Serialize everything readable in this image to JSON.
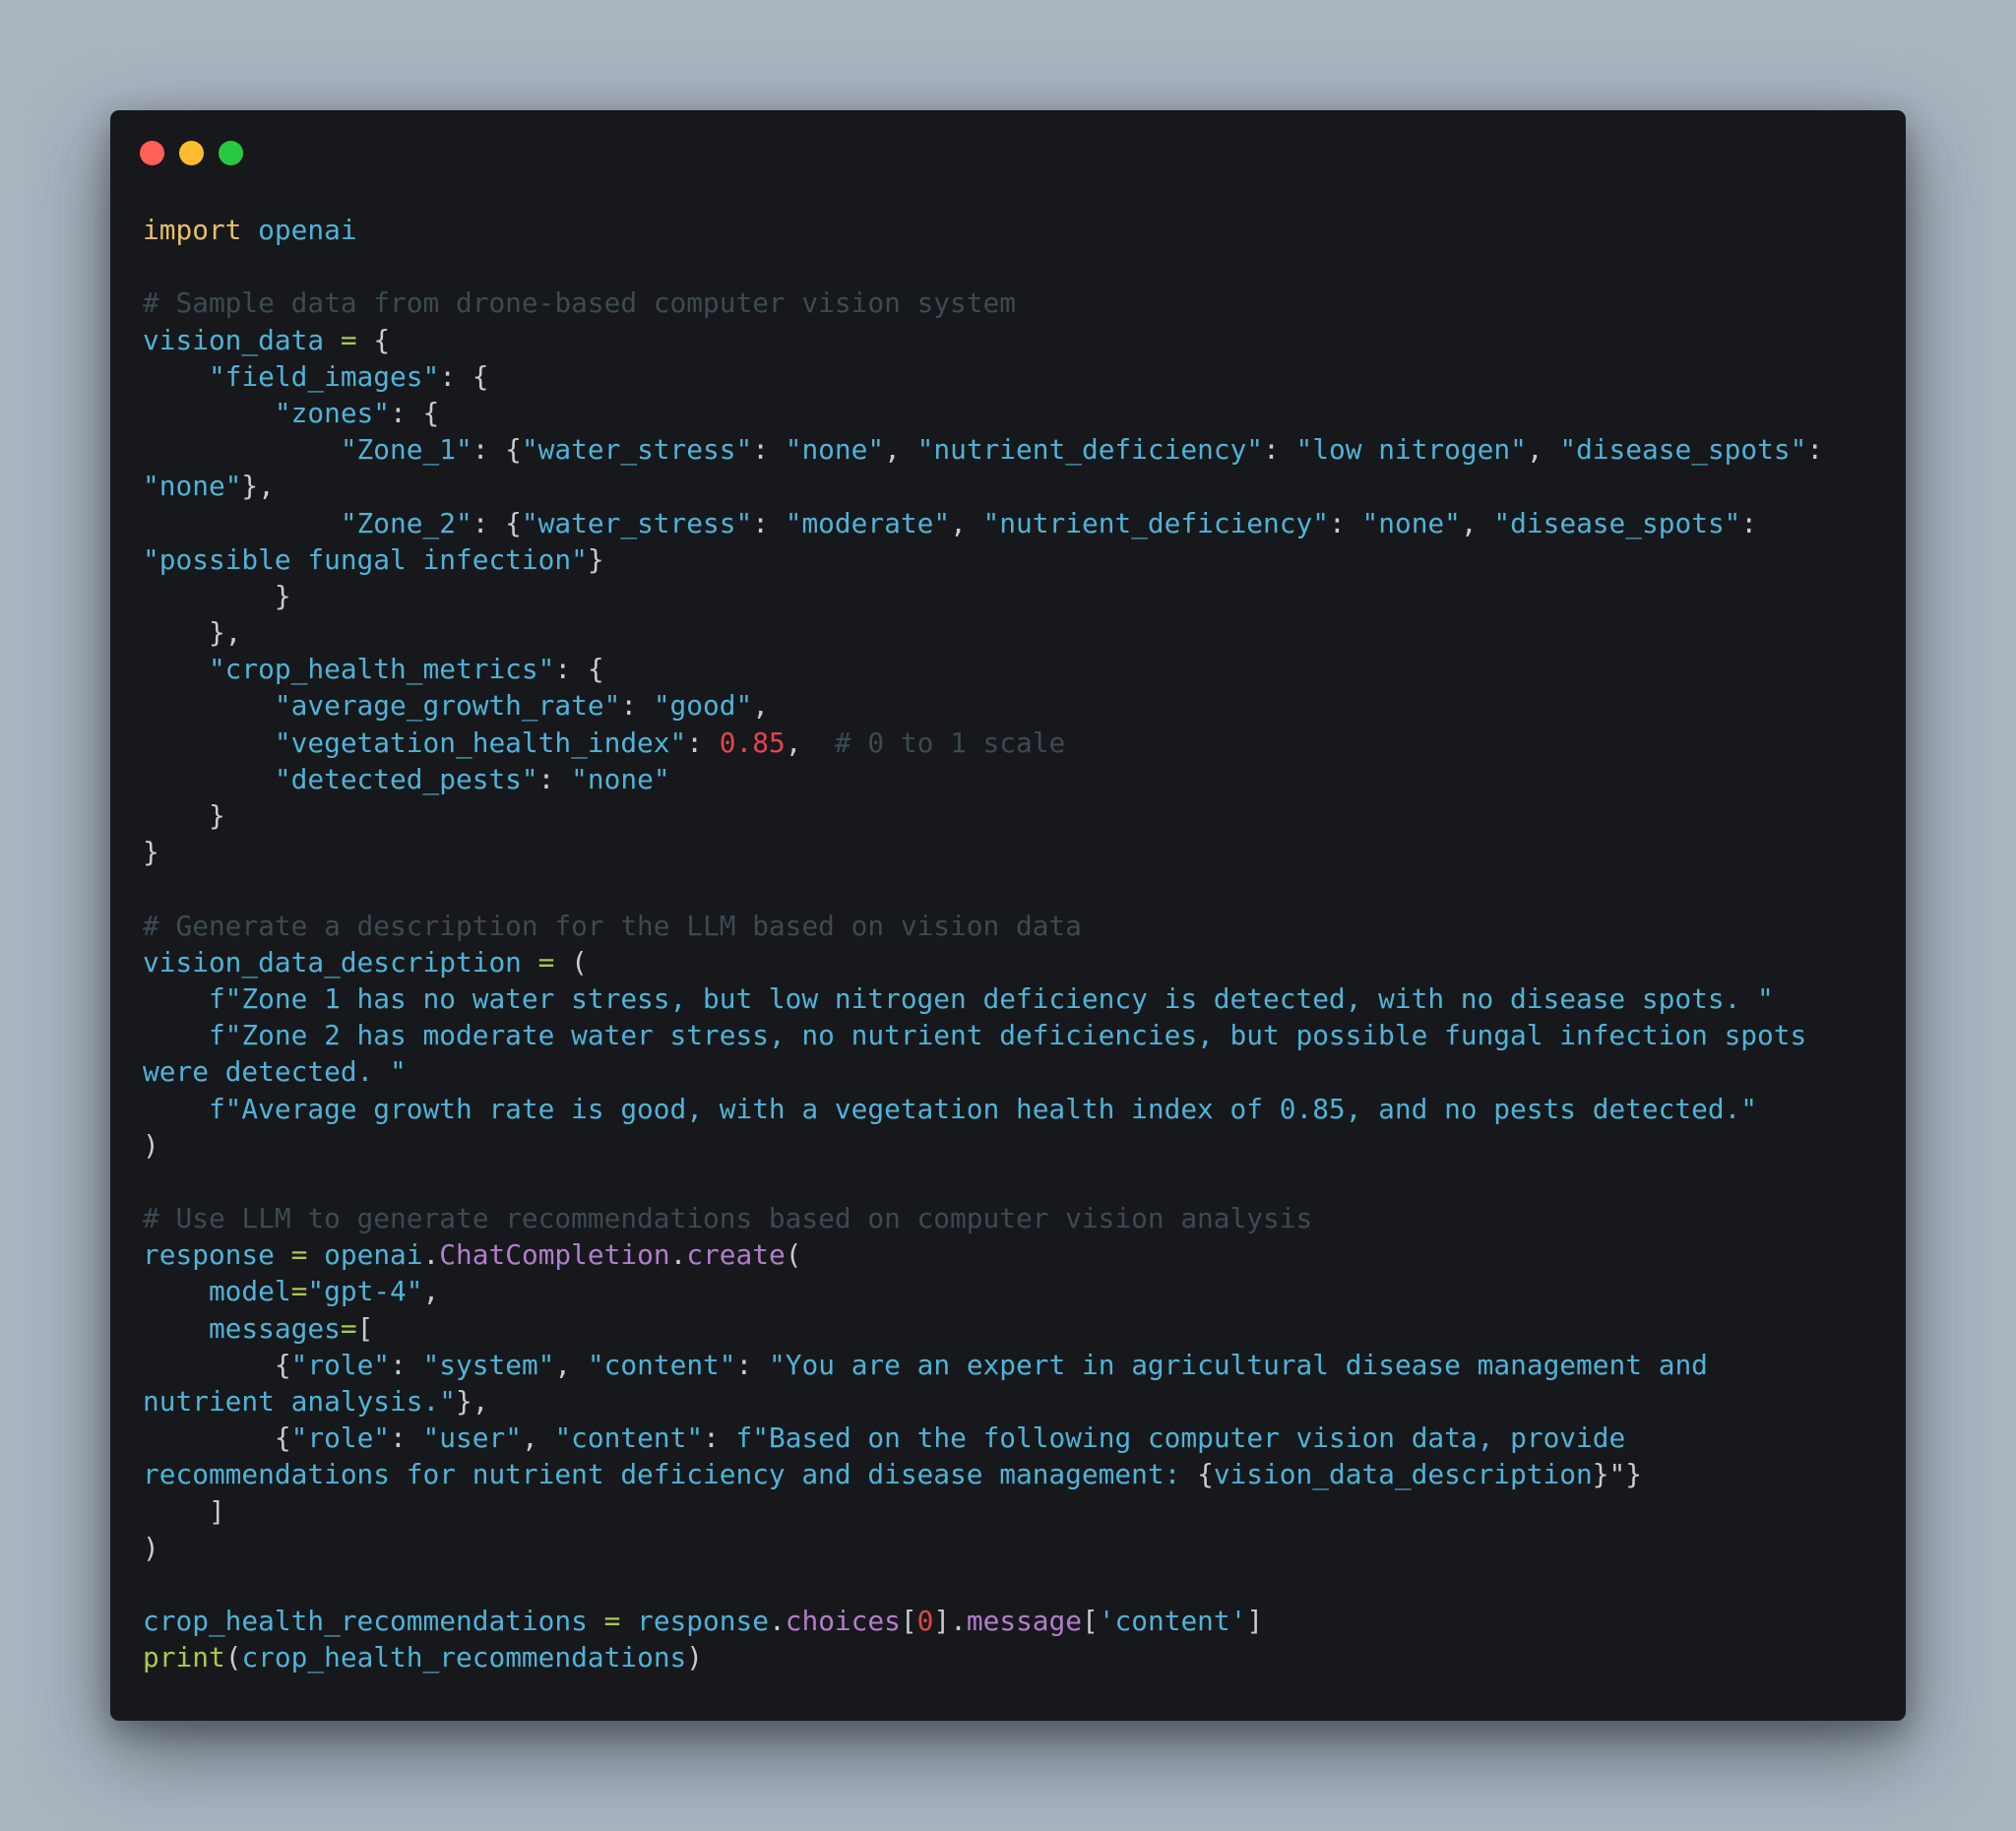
{
  "window": {
    "controls": [
      {
        "name": "close",
        "color": "#ff5f57"
      },
      {
        "name": "minimize",
        "color": "#febc2e"
      },
      {
        "name": "maximize",
        "color": "#28c840"
      }
    ]
  },
  "code": {
    "language": "python",
    "lines": [
      [
        [
          "kw",
          "import"
        ],
        [
          "var",
          " openai"
        ]
      ],
      [],
      [
        [
          "cmt",
          "# Sample data from drone-based computer vision system"
        ]
      ],
      [
        [
          "var",
          "vision_data "
        ],
        [
          "op",
          "="
        ],
        [
          "punc",
          " {"
        ]
      ],
      [
        [
          "str",
          "    \"field_images\""
        ],
        [
          "punc",
          ": {"
        ]
      ],
      [
        [
          "str",
          "        \"zones\""
        ],
        [
          "punc",
          ": {"
        ]
      ],
      [
        [
          "str",
          "            \"Zone_1\""
        ],
        [
          "punc",
          ": {"
        ],
        [
          "str",
          "\"water_stress\""
        ],
        [
          "punc",
          ": "
        ],
        [
          "str",
          "\"none\""
        ],
        [
          "punc",
          ", "
        ],
        [
          "str",
          "\"nutrient_deficiency\""
        ],
        [
          "punc",
          ": "
        ],
        [
          "str",
          "\"low nitrogen\""
        ],
        [
          "punc",
          ", "
        ],
        [
          "str",
          "\"disease_spots\""
        ],
        [
          "punc",
          ":"
        ]
      ],
      [
        [
          "str",
          "\"none\""
        ],
        [
          "punc",
          "},"
        ]
      ],
      [
        [
          "str",
          "            \"Zone_2\""
        ],
        [
          "punc",
          ": {"
        ],
        [
          "str",
          "\"water_stress\""
        ],
        [
          "punc",
          ": "
        ],
        [
          "str",
          "\"moderate\""
        ],
        [
          "punc",
          ", "
        ],
        [
          "str",
          "\"nutrient_deficiency\""
        ],
        [
          "punc",
          ": "
        ],
        [
          "str",
          "\"none\""
        ],
        [
          "punc",
          ", "
        ],
        [
          "str",
          "\"disease_spots\""
        ],
        [
          "punc",
          ":"
        ]
      ],
      [
        [
          "str",
          "\"possible fungal infection\""
        ],
        [
          "punc",
          "}"
        ]
      ],
      [
        [
          "punc",
          "        }"
        ]
      ],
      [
        [
          "punc",
          "    },"
        ]
      ],
      [
        [
          "str",
          "    \"crop_health_metrics\""
        ],
        [
          "punc",
          ": {"
        ]
      ],
      [
        [
          "str",
          "        \"average_growth_rate\""
        ],
        [
          "punc",
          ": "
        ],
        [
          "str",
          "\"good\""
        ],
        [
          "punc",
          ","
        ]
      ],
      [
        [
          "str",
          "        \"vegetation_health_index\""
        ],
        [
          "punc",
          ": "
        ],
        [
          "num",
          "0.85"
        ],
        [
          "punc",
          ",  "
        ],
        [
          "cmt",
          "# 0 to 1 scale"
        ]
      ],
      [
        [
          "str",
          "        \"detected_pests\""
        ],
        [
          "punc",
          ": "
        ],
        [
          "str",
          "\"none\""
        ]
      ],
      [
        [
          "punc",
          "    }"
        ]
      ],
      [
        [
          "punc",
          "}"
        ]
      ],
      [],
      [
        [
          "cmt",
          "# Generate a description for the LLM based on vision data"
        ]
      ],
      [
        [
          "var",
          "vision_data_description "
        ],
        [
          "op",
          "="
        ],
        [
          "punc",
          " ("
        ]
      ],
      [
        [
          "str",
          "    f\"Zone 1 has no water stress, but low nitrogen deficiency is detected, with no disease spots. \""
        ]
      ],
      [
        [
          "str",
          "    f\"Zone 2 has moderate water stress, no nutrient deficiencies, but possible fungal infection spots"
        ]
      ],
      [
        [
          "str",
          "were detected. \""
        ]
      ],
      [
        [
          "str",
          "    f\"Average growth rate is good, with a vegetation health index of 0.85, and no pests detected.\""
        ]
      ],
      [
        [
          "punc",
          ")"
        ]
      ],
      [],
      [
        [
          "cmt",
          "# Use LLM to generate recommendations based on computer vision analysis"
        ]
      ],
      [
        [
          "var",
          "response "
        ],
        [
          "op",
          "="
        ],
        [
          "var",
          " openai"
        ],
        [
          "punc",
          "."
        ],
        [
          "fn",
          "ChatCompletion"
        ],
        [
          "punc",
          "."
        ],
        [
          "fn",
          "create"
        ],
        [
          "punc",
          "("
        ]
      ],
      [
        [
          "var",
          "    model"
        ],
        [
          "op",
          "="
        ],
        [
          "str",
          "\"gpt-4\""
        ],
        [
          "punc",
          ","
        ]
      ],
      [
        [
          "var",
          "    messages"
        ],
        [
          "op",
          "="
        ],
        [
          "punc",
          "["
        ]
      ],
      [
        [
          "punc",
          "        {"
        ],
        [
          "str",
          "\"role\""
        ],
        [
          "punc",
          ": "
        ],
        [
          "str",
          "\"system\""
        ],
        [
          "punc",
          ", "
        ],
        [
          "str",
          "\"content\""
        ],
        [
          "punc",
          ": "
        ],
        [
          "str",
          "\"You are an expert in agricultural disease management and"
        ]
      ],
      [
        [
          "str",
          "nutrient analysis.\""
        ],
        [
          "punc",
          "},"
        ]
      ],
      [
        [
          "punc",
          "        {"
        ],
        [
          "str",
          "\"role\""
        ],
        [
          "punc",
          ": "
        ],
        [
          "str",
          "\"user\""
        ],
        [
          "punc",
          ", "
        ],
        [
          "str",
          "\"content\""
        ],
        [
          "punc",
          ": "
        ],
        [
          "str",
          "f\"Based on the following computer vision data, provide"
        ]
      ],
      [
        [
          "str",
          "recommendations for nutrient deficiency and disease management: "
        ],
        [
          "punc",
          "{"
        ],
        [
          "var",
          "vision_data_description"
        ],
        [
          "punc",
          "}\"}"
        ]
      ],
      [
        [
          "punc",
          "    ]"
        ]
      ],
      [
        [
          "punc",
          ")"
        ]
      ],
      [],
      [
        [
          "var",
          "crop_health_recommendations "
        ],
        [
          "op",
          "="
        ],
        [
          "var",
          " response"
        ],
        [
          "punc",
          "."
        ],
        [
          "fn",
          "choices"
        ],
        [
          "punc",
          "["
        ],
        [
          "num",
          "0"
        ],
        [
          "punc",
          "]."
        ],
        [
          "fn",
          "message"
        ],
        [
          "punc",
          "["
        ],
        [
          "str",
          "'content'"
        ],
        [
          "punc",
          "]"
        ]
      ],
      [
        [
          "builtin",
          "print"
        ],
        [
          "punc",
          "("
        ],
        [
          "var",
          "crop_health_recommendations"
        ],
        [
          "punc",
          ")"
        ]
      ]
    ]
  }
}
